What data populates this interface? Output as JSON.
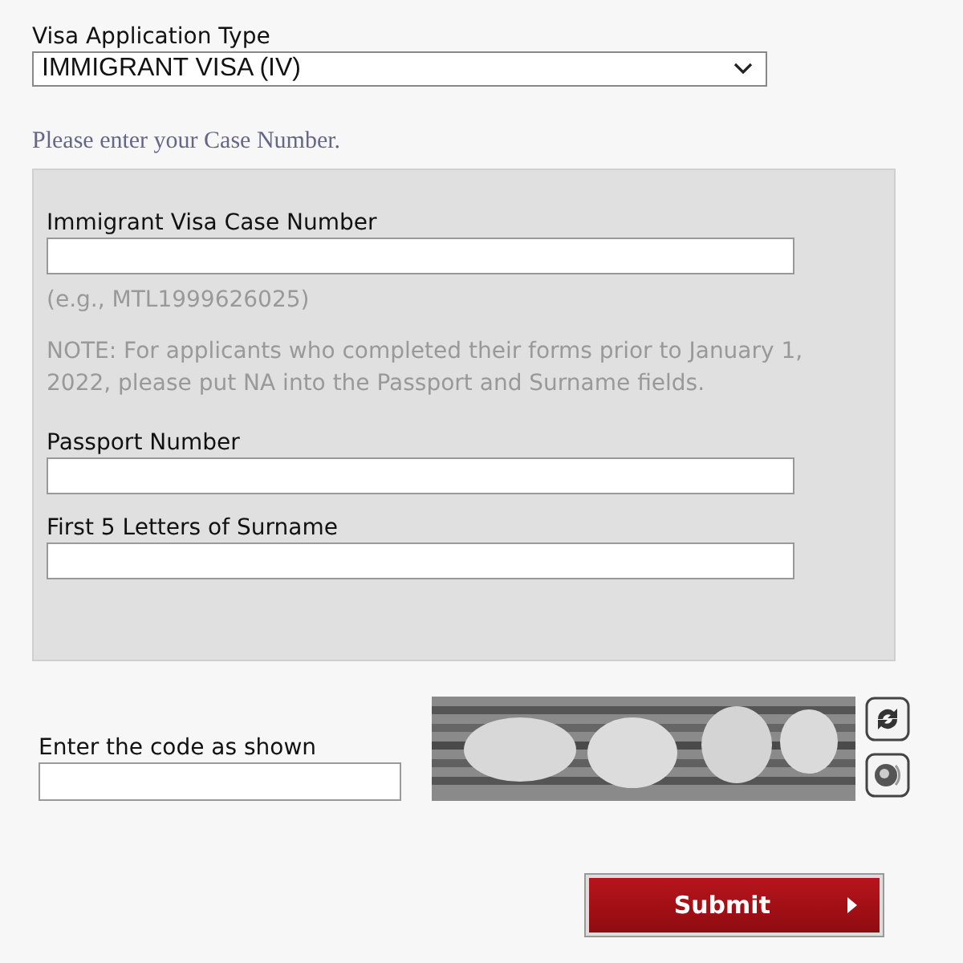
{
  "visa_type": {
    "label": "Visa Application Type",
    "value": "IMMIGRANT VISA (IV)"
  },
  "instruction": "Please enter your Case Number.",
  "case_panel": {
    "fields": [
      {
        "kind": "field",
        "label": "Immigrant Visa Case Number",
        "hint": "(e.g., MTL1999626025)"
      },
      {
        "kind": "note",
        "text": "NOTE: For applicants who completed their forms prior to January 1, 2022, please put NA into the Passport and Surname fields."
      },
      {
        "kind": "field",
        "label": "Passport Number"
      },
      {
        "kind": "field",
        "label": "First 5 Letters of Surname"
      }
    ]
  },
  "captcha": {
    "label": "Enter the code as shown"
  },
  "submit": {
    "label": "Submit"
  }
}
